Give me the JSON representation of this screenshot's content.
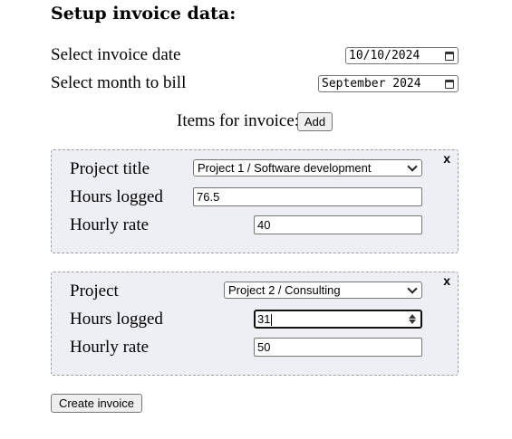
{
  "heading": "Setup invoice data:",
  "invoice_date": {
    "label": "Select invoice date",
    "value": "10/10/2024"
  },
  "bill_month": {
    "label": "Select month to bill",
    "value": "September 2024"
  },
  "items": {
    "label": "Items for invoice:",
    "add_button": "Add"
  },
  "item1": {
    "close": "x",
    "project_label": "Project title",
    "project_value": "Project 1 / Software development",
    "hours_label": "Hours logged",
    "hours_value": "76.5",
    "rate_label": "Hourly rate",
    "rate_value": "40"
  },
  "item2": {
    "close": "x",
    "project_label": "Project",
    "project_value": "Project 2 / Consulting",
    "hours_label": "Hours logged",
    "hours_value": "31",
    "rate_label": "Hourly rate",
    "rate_value": "50"
  },
  "create_button": "Create invoice"
}
